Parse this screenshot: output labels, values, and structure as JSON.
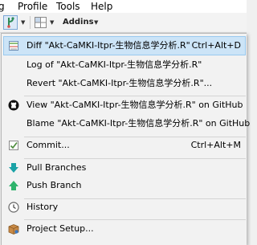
{
  "menubar": {
    "partial": "g",
    "profile": "Profile",
    "tools": "Tools",
    "help": "Help"
  },
  "toolbar": {
    "addins_label": "Addins",
    "caret": "▼"
  },
  "git_menu": {
    "items": [
      {
        "label": "Diff \"Akt-CaMKI-Itpr-生物信息学分析.R\"",
        "shortcut": "Ctrl+Alt+D",
        "icon": "diff-icon"
      },
      {
        "label": "Log of \"Akt-CaMKI-Itpr-生物信息学分析.R\"",
        "icon": ""
      },
      {
        "label": "Revert \"Akt-CaMKI-Itpr-生物信息学分析.R\"...",
        "icon": ""
      },
      {
        "label": "View \"Akt-CaMKI-Itpr-生物信息学分析.R\" on GitHub",
        "icon": "github-icon"
      },
      {
        "label": "Blame \"Akt-CaMKI-Itpr-生物信息学分析.R\" on GitHub",
        "icon": ""
      },
      {
        "label": "Commit...",
        "shortcut": "Ctrl+Alt+M",
        "icon": "commit-icon"
      },
      {
        "label": "Pull Branches",
        "icon": "pull-arrow-icon"
      },
      {
        "label": "Push Branch",
        "icon": "push-arrow-icon"
      },
      {
        "label": "History",
        "icon": "history-clock-icon"
      },
      {
        "label": "Project Setup...",
        "icon": "project-box-icon"
      }
    ]
  },
  "colors": {
    "highlight_bg": "#cce4f7",
    "pull_green": "#1aa2a6",
    "push_green": "#2eb36b"
  }
}
